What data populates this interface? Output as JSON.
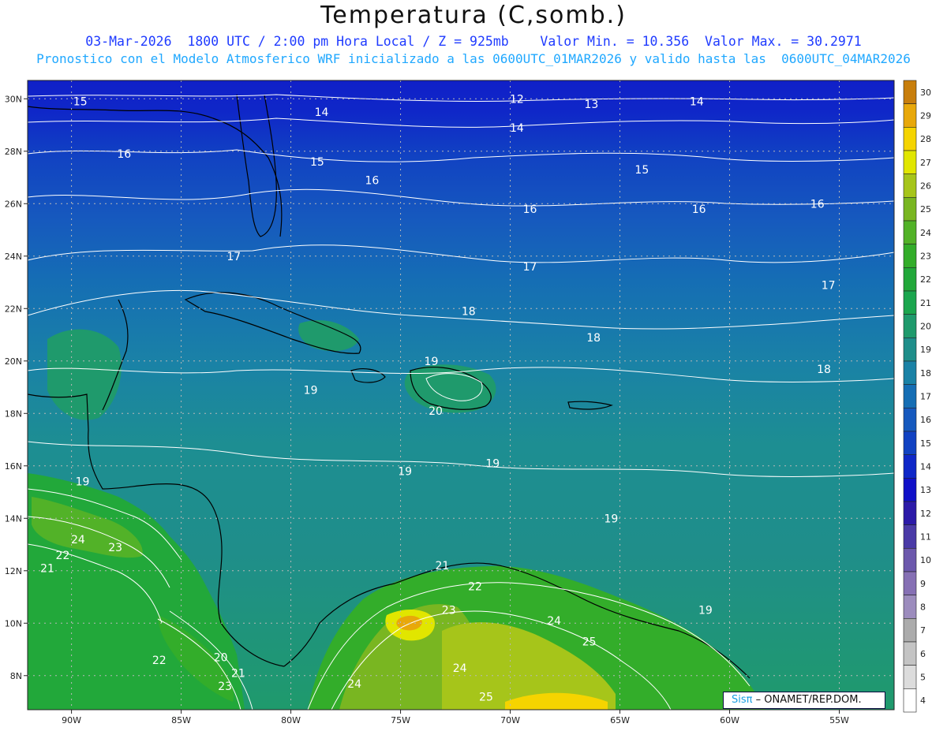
{
  "header": {
    "title": "Temperatura (C,somb.)",
    "line1": "03-Mar-2026  1800 UTC / 2:00 pm Hora Local / Z = 925mb    Valor Min. = 10.356  Valor Max. = 30.2971",
    "line2": "Pronostico con el Modelo Atmosferico WRF inicializado a las 0600UTC_01MAR2026 y valido hasta las  0600UTC_04MAR2026"
  },
  "axes": {
    "lon_labels": [
      "90W",
      "85W",
      "80W",
      "75W",
      "70W",
      "65W",
      "60W",
      "55W"
    ],
    "lat_labels": [
      "30N",
      "28N",
      "26N",
      "24N",
      "22N",
      "20N",
      "18N",
      "16N",
      "14N",
      "12N",
      "10N",
      "8N"
    ],
    "lon_values": [
      -90,
      -85,
      -80,
      -75,
      -70,
      -65,
      -60,
      -55
    ],
    "lat_values": [
      30,
      28,
      26,
      24,
      22,
      20,
      18,
      16,
      14,
      12,
      10,
      8
    ],
    "lon_range": [
      -92,
      -52.5
    ],
    "lat_range": [
      6.7,
      30.7
    ],
    "grid": "dotted"
  },
  "colorbar": {
    "levels": [
      4,
      5,
      6,
      7,
      8,
      9,
      10,
      11,
      12,
      13,
      14,
      15,
      16,
      17,
      18,
      19,
      20,
      21,
      22,
      23,
      24,
      25,
      26,
      27,
      28,
      29,
      30
    ],
    "colors": [
      "#ffffff",
      "#dcdcdc",
      "#c4c4c4",
      "#ababab",
      "#9c8cbd",
      "#8670b4",
      "#6c58ac",
      "#4a3aa7",
      "#2c1aa8",
      "#1010c8",
      "#0f27c8",
      "#1142c2",
      "#1659be",
      "#156eb4",
      "#1a82a6",
      "#1f8e8a",
      "#1f9a6c",
      "#1ba64e",
      "#22a83a",
      "#33ad2a",
      "#52b228",
      "#79b621",
      "#a6c51a",
      "#e1e600",
      "#f5d400",
      "#e8a80a",
      "#c87e0c"
    ]
  },
  "contour_labels": [
    {
      "text": "15",
      "lon": -89.6,
      "lat": 29.9
    },
    {
      "text": "14",
      "lon": -78.6,
      "lat": 29.5
    },
    {
      "text": "12",
      "lon": -69.7,
      "lat": 30.0
    },
    {
      "text": "13",
      "lon": -66.3,
      "lat": 29.8
    },
    {
      "text": "14",
      "lon": -69.7,
      "lat": 28.9
    },
    {
      "text": "14",
      "lon": -61.5,
      "lat": 29.9
    },
    {
      "text": "16",
      "lon": -87.6,
      "lat": 27.9
    },
    {
      "text": "15",
      "lon": -78.8,
      "lat": 27.6
    },
    {
      "text": "15",
      "lon": -64.0,
      "lat": 27.3
    },
    {
      "text": "16",
      "lon": -76.3,
      "lat": 26.9
    },
    {
      "text": "16",
      "lon": -69.1,
      "lat": 25.8
    },
    {
      "text": "16",
      "lon": -61.4,
      "lat": 25.8
    },
    {
      "text": "16",
      "lon": -56.0,
      "lat": 26.0
    },
    {
      "text": "17",
      "lon": -82.6,
      "lat": 24.0
    },
    {
      "text": "17",
      "lon": -69.1,
      "lat": 23.6
    },
    {
      "text": "17",
      "lon": -55.5,
      "lat": 22.9
    },
    {
      "text": "18",
      "lon": -71.9,
      "lat": 21.9
    },
    {
      "text": "18",
      "lon": -66.2,
      "lat": 20.9
    },
    {
      "text": "18",
      "lon": -55.7,
      "lat": 19.7
    },
    {
      "text": "19",
      "lon": -73.6,
      "lat": 20.0
    },
    {
      "text": "19",
      "lon": -79.1,
      "lat": 18.9
    },
    {
      "text": "20",
      "lon": -73.4,
      "lat": 18.1
    },
    {
      "text": "19",
      "lon": -74.8,
      "lat": 15.8
    },
    {
      "text": "19",
      "lon": -70.8,
      "lat": 16.1
    },
    {
      "text": "19",
      "lon": -89.5,
      "lat": 15.4
    },
    {
      "text": "19",
      "lon": -65.4,
      "lat": 14.0
    },
    {
      "text": "24",
      "lon": -89.7,
      "lat": 13.2
    },
    {
      "text": "23",
      "lon": -88.0,
      "lat": 12.9
    },
    {
      "text": "22",
      "lon": -90.4,
      "lat": 12.6
    },
    {
      "text": "21",
      "lon": -91.1,
      "lat": 12.1
    },
    {
      "text": "21",
      "lon": -73.1,
      "lat": 12.2
    },
    {
      "text": "22",
      "lon": -71.6,
      "lat": 11.4
    },
    {
      "text": "23",
      "lon": -72.8,
      "lat": 10.5
    },
    {
      "text": "24",
      "lon": -68.0,
      "lat": 10.1
    },
    {
      "text": "25",
      "lon": -66.4,
      "lat": 9.3
    },
    {
      "text": "19",
      "lon": -61.1,
      "lat": 10.5
    },
    {
      "text": "20",
      "lon": -83.2,
      "lat": 8.7
    },
    {
      "text": "21",
      "lon": -82.4,
      "lat": 8.1
    },
    {
      "text": "22",
      "lon": -86.0,
      "lat": 8.6
    },
    {
      "text": "23",
      "lon": -83.0,
      "lat": 7.6
    },
    {
      "text": "24",
      "lon": -72.3,
      "lat": 8.3
    },
    {
      "text": "24",
      "lon": -77.1,
      "lat": 7.7
    },
    {
      "text": "25",
      "lon": -71.1,
      "lat": 7.2
    }
  ],
  "credit": {
    "brand": "Sisπ",
    "text": "– ONAMET/REP.DOM."
  }
}
